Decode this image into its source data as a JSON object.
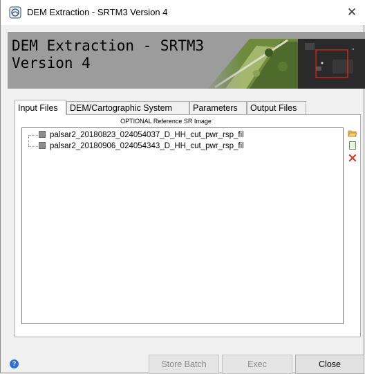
{
  "window": {
    "title": "DEM Extraction - SRTM3 Version 4",
    "close_glyph": "✕"
  },
  "banner": {
    "title": "DEM Extraction - SRTM3\nVersion 4"
  },
  "tabs": [
    {
      "label": "Input Files",
      "active": true
    },
    {
      "label": "DEM/Cartographic System",
      "active": false
    },
    {
      "label": "Parameters",
      "active": false
    },
    {
      "label": "Output Files",
      "active": false
    }
  ],
  "input_panel": {
    "section_label": "OPTIONAL Reference SR Image",
    "files": [
      "palsar2_20180823_024054037_D_HH_cut_pwr_rsp_fil",
      "palsar2_20180906_024054343_D_HH_cut_pwr_rsp_fil"
    ]
  },
  "side_buttons": {
    "open": "open-folder-icon",
    "new": "new-file-icon",
    "delete": "delete-icon"
  },
  "buttons": {
    "store_batch": "Store Batch",
    "exec": "Exec",
    "close": "Close"
  },
  "help": {
    "glyph": "?"
  },
  "colors": {
    "delete": "#d83a2a",
    "folder": "#e8b84a",
    "help": "#2a6fd6"
  }
}
